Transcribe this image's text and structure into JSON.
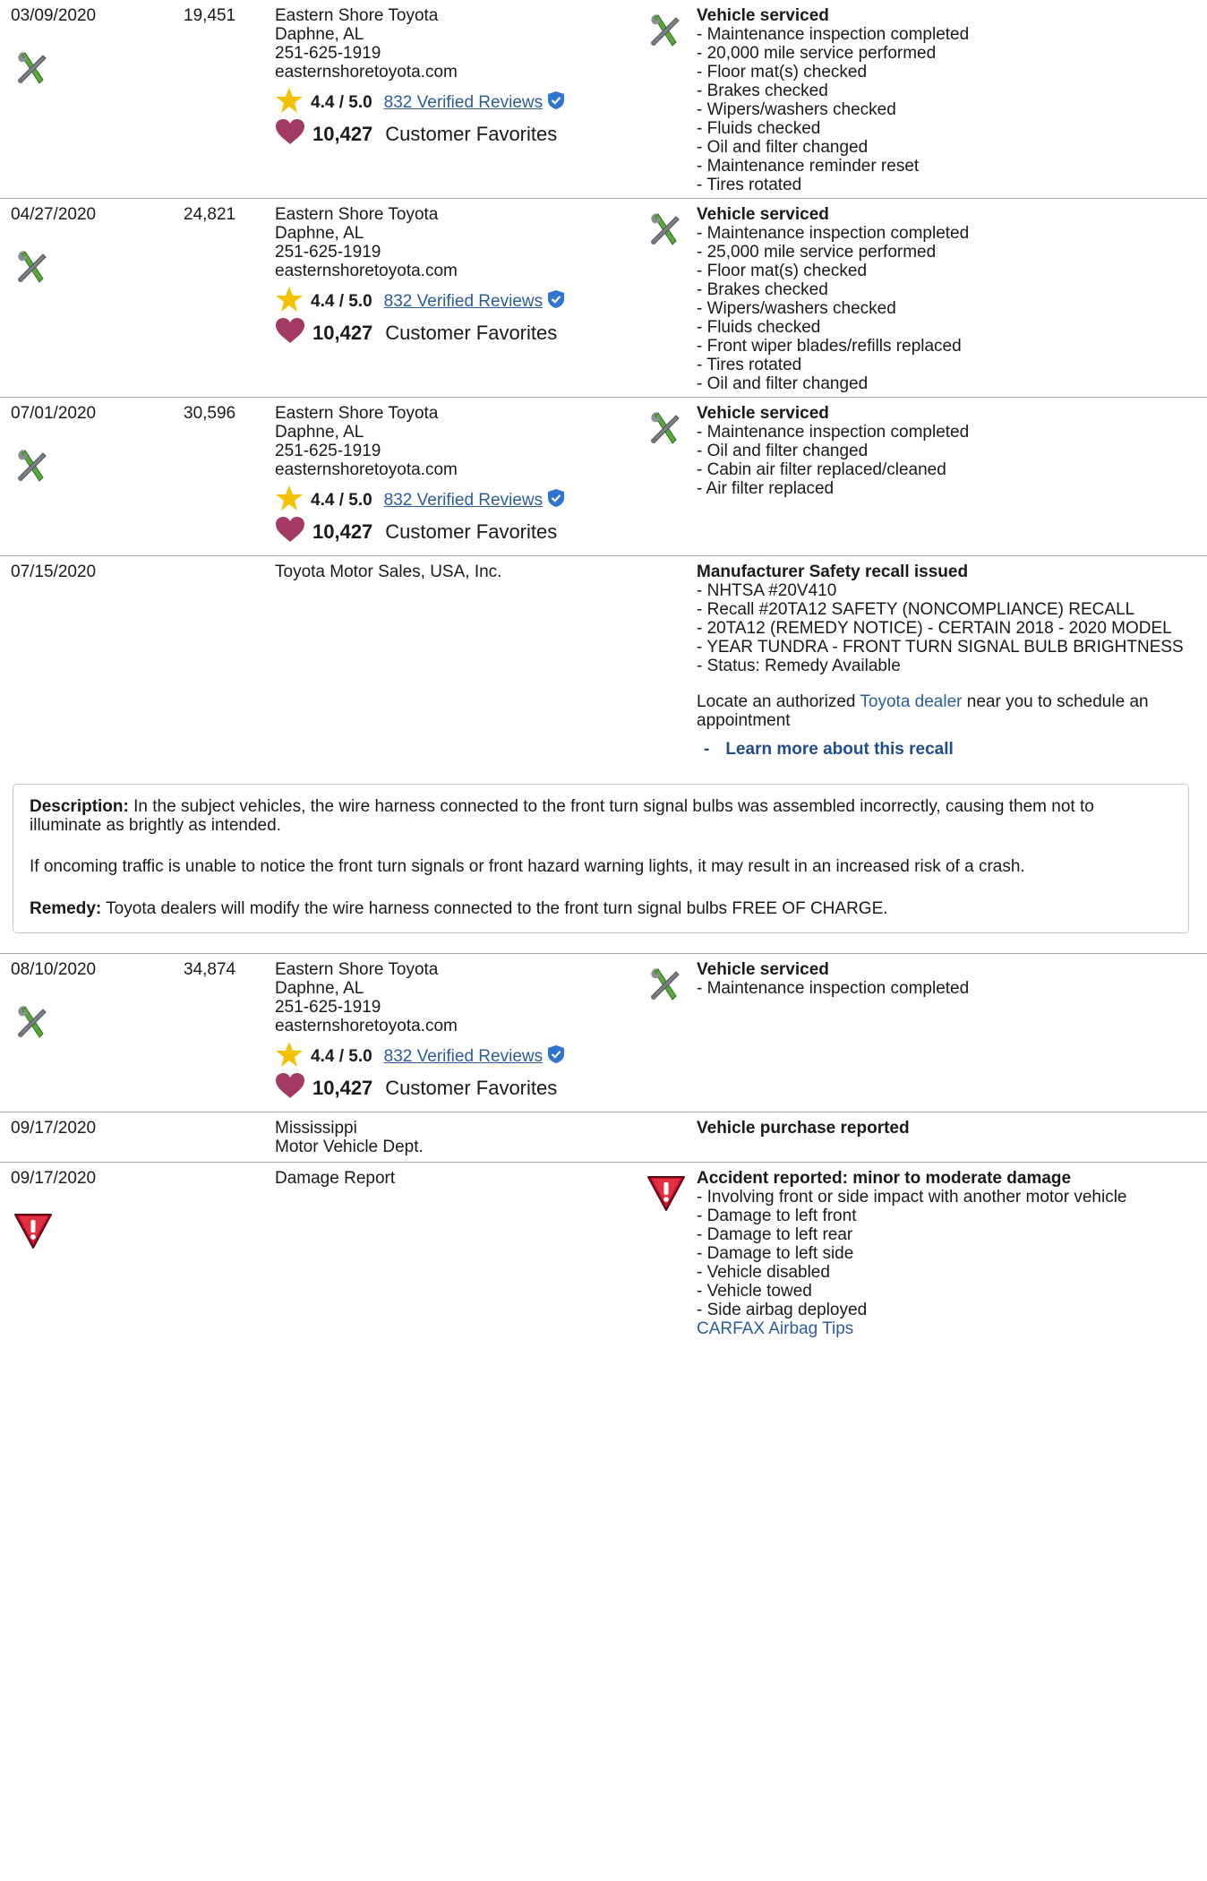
{
  "records": [
    {
      "date": "03/09/2020",
      "odometer": "19,451",
      "source": [
        "Eastern Shore Toyota",
        "Daphne, AL",
        "251-625-1919",
        "easternshoretoyota.com"
      ],
      "rating": "4.4 / 5.0",
      "reviews_link": "832 Verified Reviews",
      "favorites_count": "10,427",
      "favorites_label": "Customer Favorites",
      "comment_title": "Vehicle serviced",
      "comment_lines": [
        "- Maintenance inspection completed",
        "- 20,000 mile service performed",
        "- Floor mat(s) checked",
        "- Brakes checked",
        "- Wipers/washers checked",
        "- Fluids checked",
        "- Oil and filter changed",
        "- Maintenance reminder reset",
        "- Tires rotated"
      ]
    },
    {
      "date": "04/27/2020",
      "odometer": "24,821",
      "source": [
        "Eastern Shore Toyota",
        "Daphne, AL",
        "251-625-1919",
        "easternshoretoyota.com"
      ],
      "rating": "4.4 / 5.0",
      "reviews_link": "832 Verified Reviews",
      "favorites_count": "10,427",
      "favorites_label": "Customer Favorites",
      "comment_title": "Vehicle serviced",
      "comment_lines": [
        "- Maintenance inspection completed",
        "- 25,000 mile service performed",
        "- Floor mat(s) checked",
        "- Brakes checked",
        "- Wipers/washers checked",
        "- Fluids checked",
        "- Front wiper blades/refills replaced",
        "- Tires rotated",
        "- Oil and filter changed"
      ]
    },
    {
      "date": "07/01/2020",
      "odometer": "30,596",
      "source": [
        "Eastern Shore Toyota",
        "Daphne, AL",
        "251-625-1919",
        "easternshoretoyota.com"
      ],
      "rating": "4.4 / 5.0",
      "reviews_link": "832 Verified Reviews",
      "favorites_count": "10,427",
      "favorites_label": "Customer Favorites",
      "comment_title": "Vehicle serviced",
      "comment_lines": [
        "- Maintenance inspection completed",
        "- Oil and filter changed",
        "- Cabin air filter replaced/cleaned",
        "- Air filter replaced"
      ]
    },
    {
      "date": "07/15/2020",
      "source": [
        "Toyota Motor Sales, USA, Inc."
      ],
      "comment_title": "Manufacturer Safety recall issued",
      "comment_lines": [
        "- NHTSA #20V410",
        "- Recall #20TA12 SAFETY (NONCOMPLIANCE) RECALL",
        "- 20TA12 (REMEDY NOTICE) - CERTAIN 2018 - 2020 MODEL",
        "- YEAR TUNDRA - FRONT TURN SIGNAL BULB BRIGHTNESS",
        "- Status: Remedy Available"
      ],
      "locate_prefix": "Locate an authorized ",
      "locate_link": "Toyota dealer",
      "locate_suffix": " near you to schedule an",
      "locate_line2": "appointment",
      "learn_dash": "-",
      "learn_more": "Learn more about this recall",
      "description_label": "Description:",
      "description_text": " In the subject vehicles, the wire harness connected to the front turn signal bulbs was assembled incorrectly, causing them not to",
      "description_text2": "illuminate as brightly as intended.",
      "risk_text": "If oncoming traffic is unable to notice the front turn signals or front hazard warning lights, it may result in an increased risk of a crash.",
      "remedy_label": "Remedy:",
      "remedy_text": " Toyota dealers will modify the wire harness connected to the front turn signal bulbs FREE OF CHARGE."
    },
    {
      "date": "08/10/2020",
      "odometer": "34,874",
      "source": [
        "Eastern Shore Toyota",
        "Daphne, AL",
        "251-625-1919",
        "easternshoretoyota.com"
      ],
      "rating": "4.4 / 5.0",
      "reviews_link": "832 Verified Reviews",
      "favorites_count": "10,427",
      "favorites_label": "Customer Favorites",
      "comment_title": "Vehicle serviced",
      "comment_lines": [
        "- Maintenance inspection completed"
      ]
    },
    {
      "date": "09/17/2020",
      "source": [
        "Mississippi",
        "Motor Vehicle Dept."
      ],
      "comment_title": "Vehicle purchase reported"
    },
    {
      "date": "09/17/2020",
      "source": [
        "Damage Report"
      ],
      "comment_title": "Accident reported: minor to moderate damage",
      "comment_lines": [
        "- Involving front or side impact with another motor vehicle",
        "- Damage to left front",
        "- Damage to left rear",
        "- Damage to left side",
        "- Vehicle disabled",
        "- Vehicle towed",
        "- Side airbag deployed"
      ],
      "airbag_link": "CARFAX Airbag Tips"
    }
  ],
  "icons": {
    "service": "wrench-screwdriver-icon",
    "rating": "star-icon",
    "verified": "verified-badge-icon",
    "favorites": "heart-icon",
    "damage": "warning-triangle-icon"
  },
  "colors": {
    "link": "#2c5b9c",
    "star": "#f2c200",
    "heart": "#a33a64",
    "verified": "#2f74d0",
    "damage": "#c8102e",
    "divider": "#a8a8a8"
  }
}
